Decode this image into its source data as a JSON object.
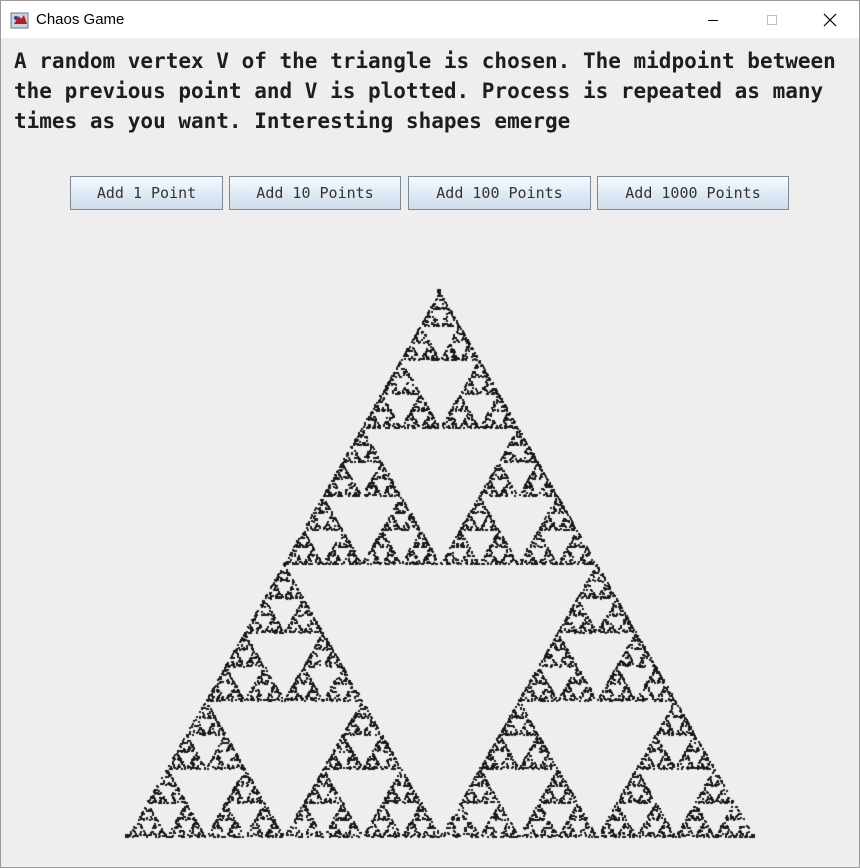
{
  "window": {
    "title": "Chaos Game"
  },
  "description": "A random vertex V of the triangle is chosen. The midpoint between the previous point and V is plotted. Process is repeated as many times as you want. Interesting shapes emerge",
  "buttons": [
    {
      "label": "Add 1 Point"
    },
    {
      "label": "Add 10 Points"
    },
    {
      "label": "Add 100 Points"
    },
    {
      "label": "Add 1000 Points"
    }
  ],
  "plot": {
    "point_color": "#1a1a1a",
    "point_count": 12000
  },
  "icons": {
    "minimize": "minimize-icon",
    "maximize": "maximize-icon",
    "close": "close-icon",
    "app": "java-app-icon"
  }
}
